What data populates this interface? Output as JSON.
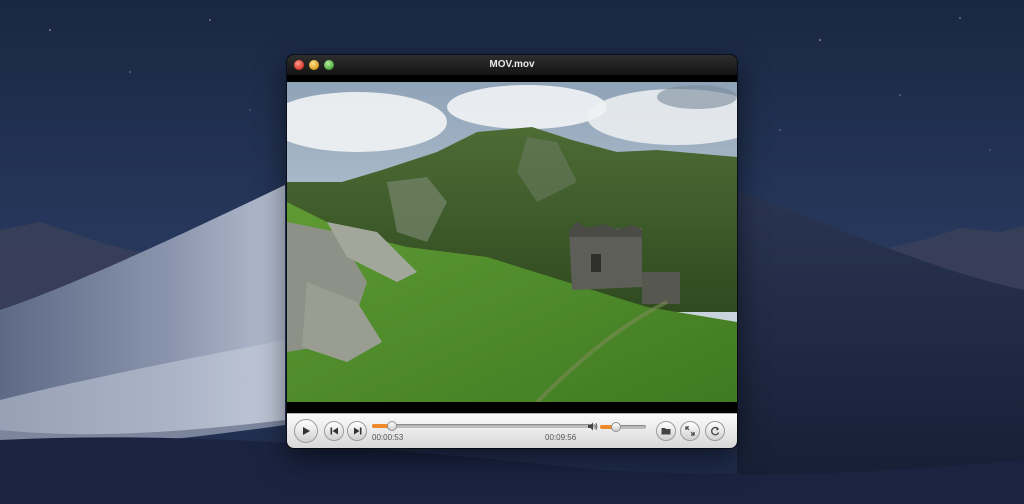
{
  "window": {
    "title": "MOV.mov"
  },
  "playback": {
    "elapsed": "00:00:53",
    "total": "00:09:56",
    "progress": 0.089,
    "volume": 0.35,
    "state": "paused"
  },
  "icons": {
    "play": "play-icon",
    "prev": "skip-back-icon",
    "next": "skip-forward-icon",
    "volume": "speaker-icon",
    "open": "folder-icon",
    "fullscreen": "expand-icon",
    "loop": "loop-icon"
  },
  "colors": {
    "accent": "#ef8a2c"
  }
}
